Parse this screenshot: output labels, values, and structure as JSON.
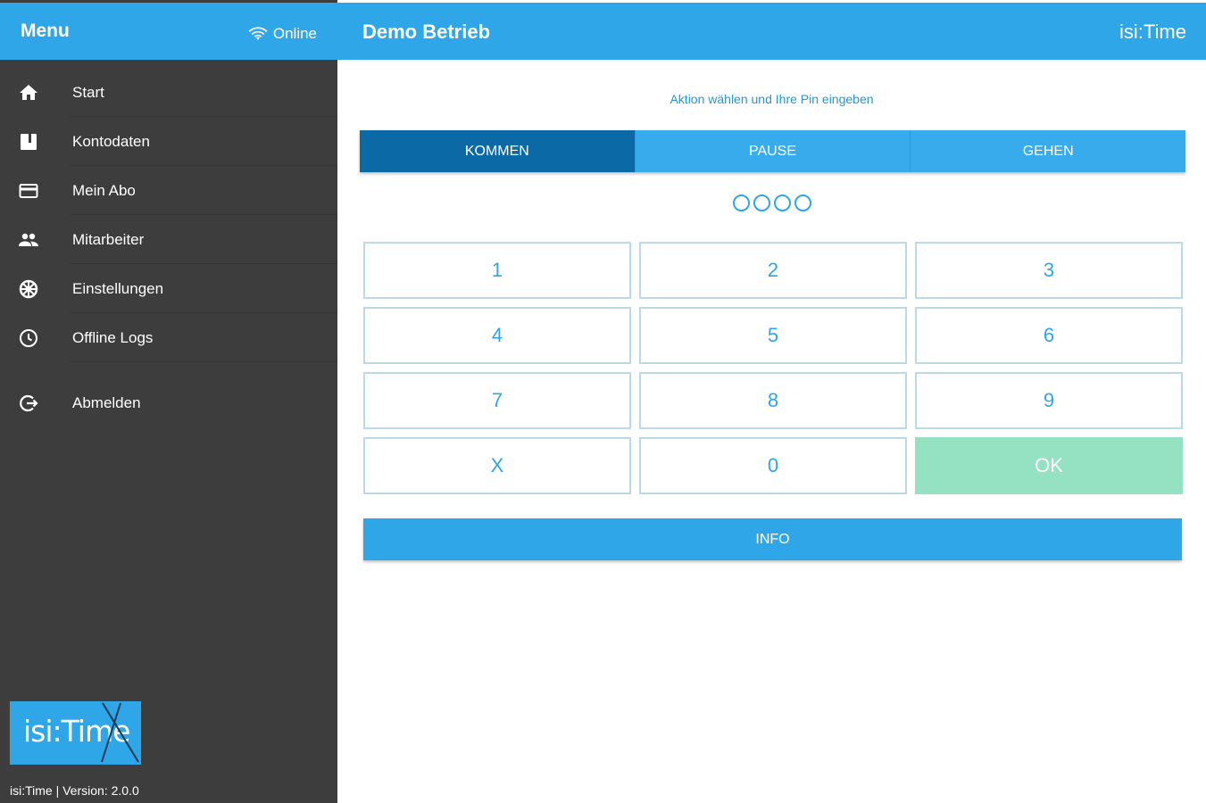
{
  "sidebar": {
    "title": "Menu",
    "status": "Online",
    "items": [
      {
        "label": "Start",
        "icon": "home-icon"
      },
      {
        "label": "Kontodaten",
        "icon": "book-icon"
      },
      {
        "label": "Mein Abo",
        "icon": "credit-card-icon"
      },
      {
        "label": "Mitarbeiter",
        "icon": "people-icon"
      },
      {
        "label": "Einstellungen",
        "icon": "gear-icon"
      },
      {
        "label": "Offline Logs",
        "icon": "clock-icon"
      },
      {
        "label": "Abmelden",
        "icon": "logout-icon"
      }
    ],
    "logo_text": "isi:Time",
    "version": "isi:Time | Version: 2.0.0"
  },
  "header": {
    "title": "Demo Betrieb",
    "brand": "isi:Time"
  },
  "main": {
    "instruction": "Aktion wählen und Ihre Pin eingeben",
    "tabs": [
      {
        "label": "KOMMEN",
        "active": true
      },
      {
        "label": "PAUSE",
        "active": false
      },
      {
        "label": "GEHEN",
        "active": false
      }
    ],
    "pin_length": 4,
    "keys": [
      "1",
      "2",
      "3",
      "4",
      "5",
      "6",
      "7",
      "8",
      "9",
      "X",
      "0",
      "OK"
    ],
    "info_label": "INFO"
  },
  "colors": {
    "accent": "#2ea6e8",
    "active_tab": "#0b6aa6",
    "sidebar_bg": "#3d3d3d",
    "ok_button": "#95e2c3"
  }
}
